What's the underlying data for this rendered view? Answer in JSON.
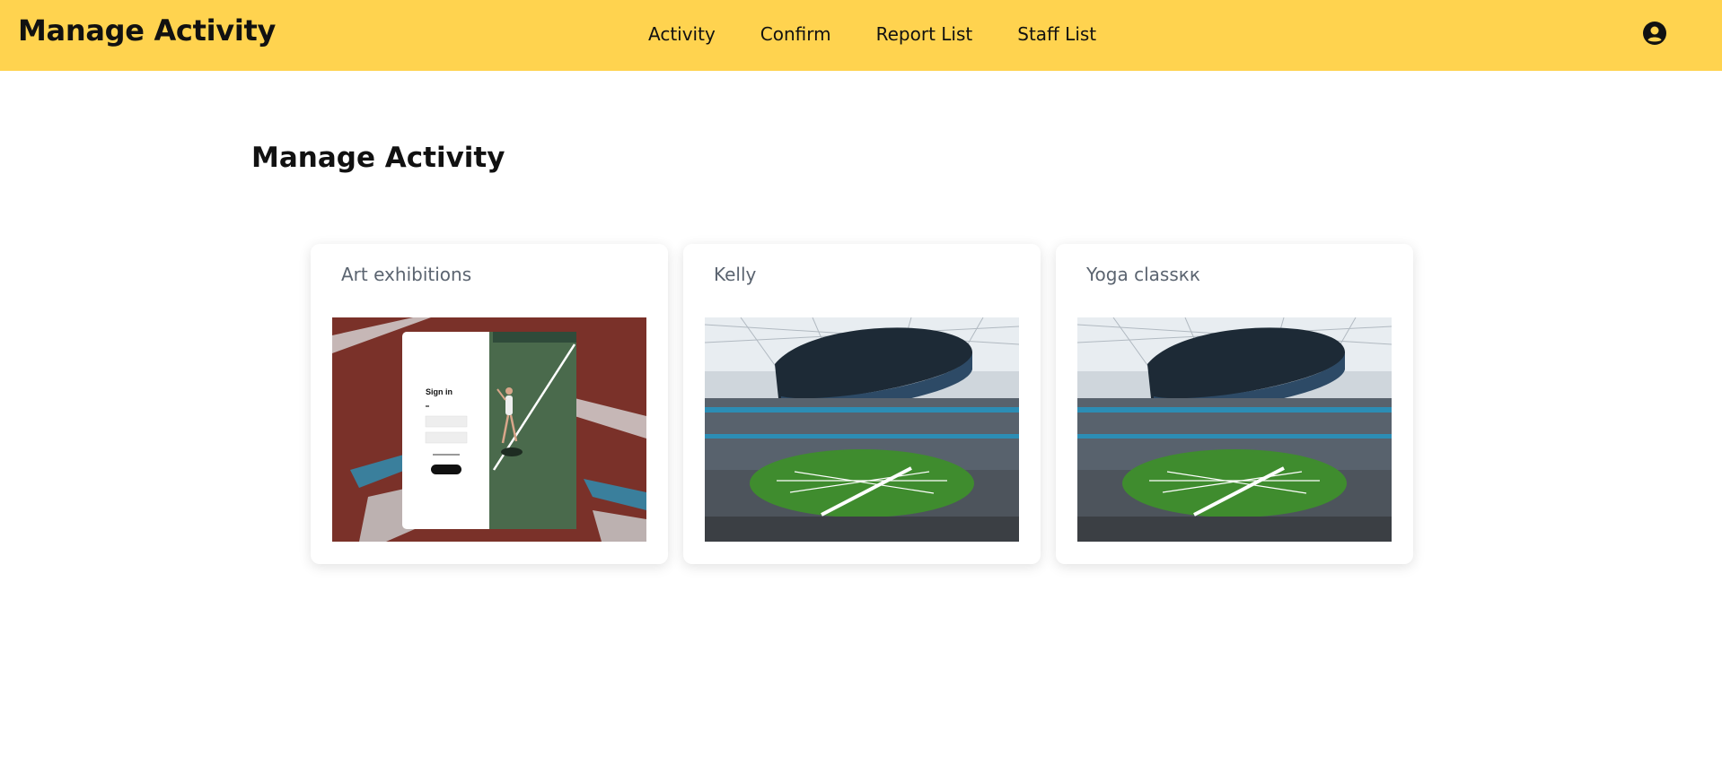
{
  "app": {
    "title": "Manage Activity"
  },
  "nav": {
    "items": [
      "Activity",
      "Confirm",
      "Report List",
      "Staff List"
    ]
  },
  "user": {
    "icon": "user-circle-icon"
  },
  "main": {
    "title": "Manage Activity"
  },
  "activities": [
    {
      "title": "Art exhibitions",
      "image": "sign-in-tennis-thumbnail"
    },
    {
      "title": "Kelly",
      "image": "stadium-thumbnail"
    },
    {
      "title": "Yoga classкк",
      "image": "stadium-thumbnail"
    }
  ],
  "colors": {
    "header_bg": "#ffd34f",
    "card_title": "#5b6470"
  },
  "thumbnail_text": {
    "sign_in": "Sign in"
  }
}
